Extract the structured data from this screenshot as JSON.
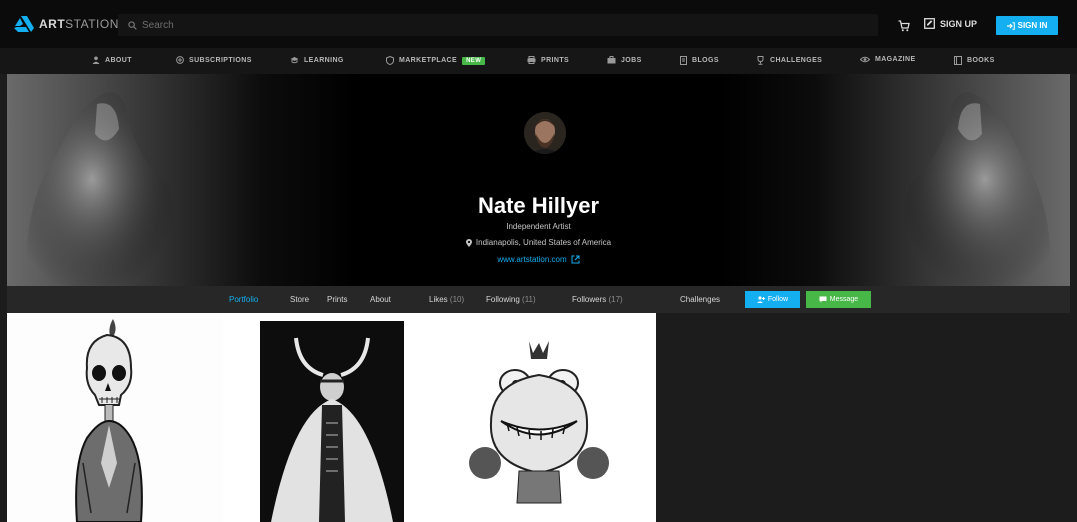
{
  "brand": {
    "name_bold": "ART",
    "name_thin": "STATION",
    "accent": "#13aff0",
    "green": "#47b848"
  },
  "search": {
    "placeholder": "Search"
  },
  "header": {
    "cart_icon": "cart-icon",
    "signup_label": "SIGN UP",
    "signin_label": "SIGN IN"
  },
  "nav": {
    "items": [
      {
        "label": "ABOUT",
        "icon": "user-icon"
      },
      {
        "label": "SUBSCRIPTIONS",
        "icon": "plus-circle-icon"
      },
      {
        "label": "LEARNING",
        "icon": "graduation-icon"
      },
      {
        "label": "MARKETPLACE",
        "icon": "shield-icon",
        "badge": "NEW"
      },
      {
        "label": "PRINTS",
        "icon": "print-icon"
      },
      {
        "label": "JOBS",
        "icon": "briefcase-icon"
      },
      {
        "label": "BLOGS",
        "icon": "document-icon"
      },
      {
        "label": "CHALLENGES",
        "icon": "trophy-icon"
      },
      {
        "label": "MAGAZINE",
        "icon": "eye-icon"
      },
      {
        "label": "BOOKS",
        "icon": "book-icon"
      }
    ]
  },
  "profile": {
    "name": "Nate Hillyer",
    "headline": "Independent Artist",
    "location": "Indianapolis, United States of America",
    "website": "www.artstation.com"
  },
  "tabs": {
    "items": [
      {
        "label": "Portfolio",
        "count": ""
      },
      {
        "label": "Store",
        "count": ""
      },
      {
        "label": "Prints",
        "count": ""
      },
      {
        "label": "About",
        "count": ""
      },
      {
        "label": "Likes",
        "count": "(10)"
      },
      {
        "label": "Following",
        "count": "(11)"
      },
      {
        "label": "Followers",
        "count": "(17)"
      },
      {
        "label": "Challenges",
        "count": ""
      }
    ],
    "active": "Portfolio",
    "follow_label": "Follow",
    "message_label": "Message"
  }
}
